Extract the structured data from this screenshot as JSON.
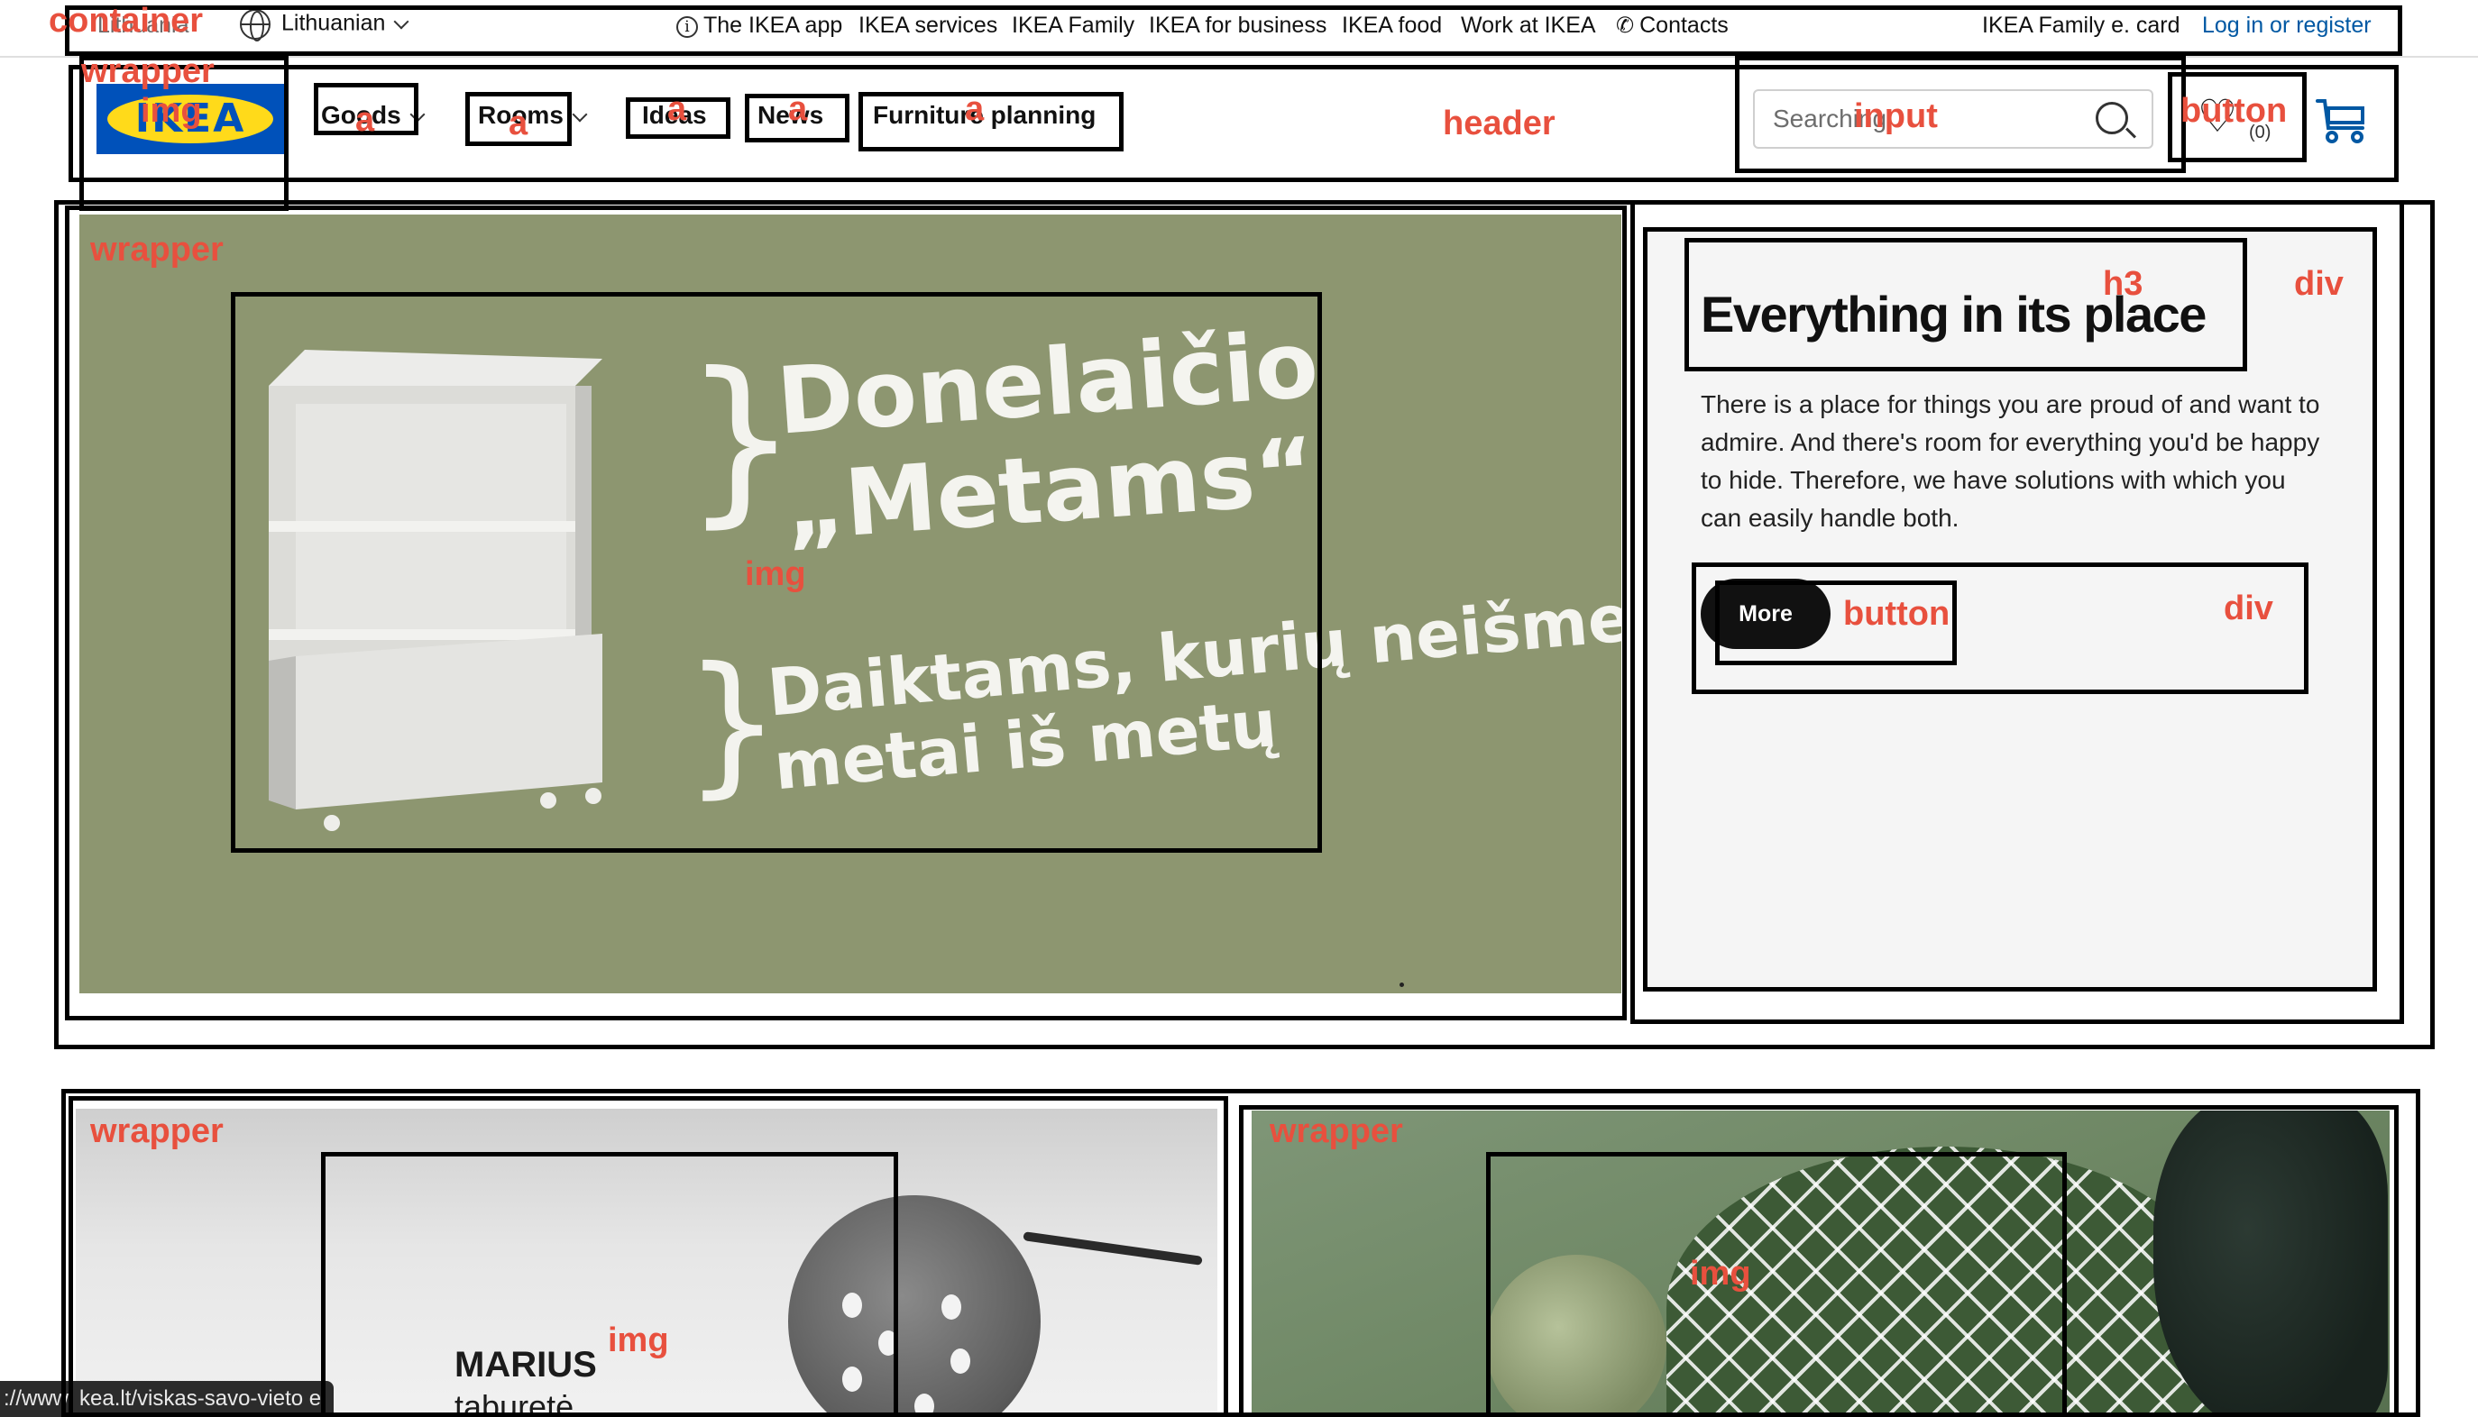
{
  "topbar": {
    "country": "Lithuania",
    "language": "Lithuanian",
    "links": [
      "The IKEA app",
      "IKEA services",
      "IKEA Family",
      "IKEA for business",
      "IKEA food",
      "Work at IKEA",
      "Contacts"
    ],
    "family_card": "IKEA Family e. card",
    "login": "Log in or register"
  },
  "header": {
    "logo_text": "IKEA",
    "nav": [
      "Goods",
      "Rooms",
      "Ideas",
      "News",
      "Furniture planning"
    ],
    "search_placeholder": "Searching",
    "favorites_count": "(0)"
  },
  "hero": {
    "title_line1": "Donelaičio",
    "title_line2": "„Metams“",
    "subtitle_line1": "Daiktams, kurių neišmeti",
    "subtitle_line2": "metai iš metų",
    "card_title": "Everything in its place",
    "card_text": "There is a place for things you are proud of and want to admire. And there's room for everything you'd be happy to hide. Therefore, we have solutions with which you can easily handle both.",
    "more_label": "More"
  },
  "tiles": {
    "product_name": "MARIUS",
    "product_type": "taburetė"
  },
  "status_bar": {
    "url": "://www. kea.lt/viskas-savo-vieto e"
  },
  "annotations": {
    "container": "container",
    "wrapper_logo": "wrapper",
    "img_logo": "img",
    "a_goods": "a",
    "a_rooms": "a",
    "a_ideas": "a",
    "a_news": "a",
    "a_planning": "a",
    "header": "header",
    "input": "input",
    "button_fav": "button",
    "wrapper_hero": "wrapper",
    "img_hero": "img",
    "h3": "h3",
    "div_card": "div",
    "button_more": "button",
    "div_btn": "div",
    "wrapper_tile1": "wrapper",
    "img_tile1": "img",
    "wrapper_tile2": "wrapper",
    "img_tile2": "img"
  },
  "colors": {
    "brand_blue": "#0051ba",
    "brand_yellow": "#ffda1a",
    "hero_green": "#8d9670",
    "annotation_red": "#e8503e",
    "link_blue": "#0058a3"
  }
}
